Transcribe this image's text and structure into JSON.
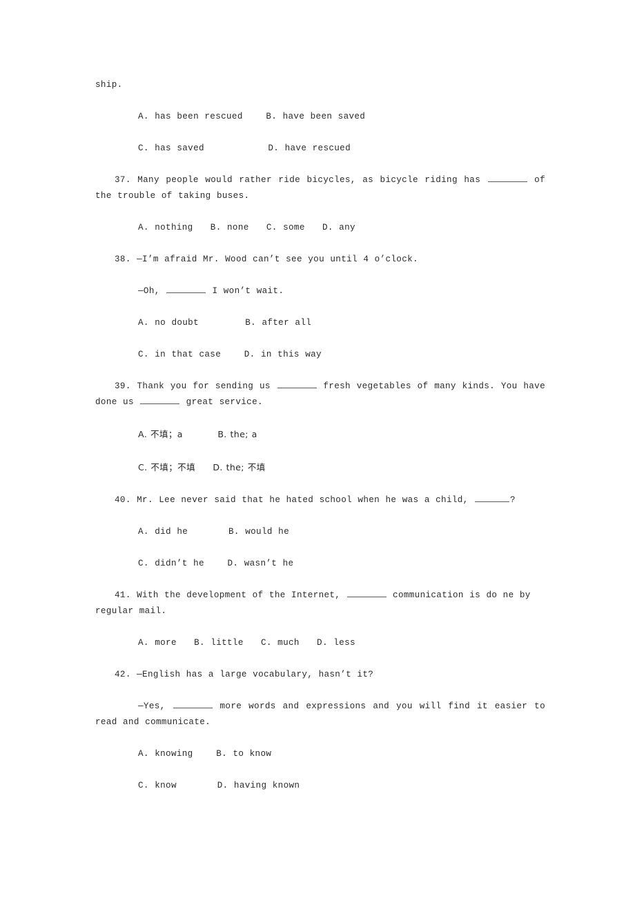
{
  "document": {
    "type": "english-exam-worksheet",
    "language": "en-zh",
    "continued_fragment": "ship.",
    "blank_marker": "________"
  },
  "questions": [
    {
      "number": "",
      "stem_lines": [],
      "options": [
        {
          "label": "A.",
          "text": "has been rescued"
        },
        {
          "label": "B.",
          "text": "have been saved"
        },
        {
          "label": "C.",
          "text": "has saved"
        },
        {
          "label": "D.",
          "text": "have rescued"
        }
      ],
      "option_row_1": "A. has been rescued    B. have been saved",
      "option_row_2": "C. has saved           D. have rescued"
    },
    {
      "number": "37.",
      "stem_before_blank": "37. Many people would rather ride bicycles, as bicycle riding has ",
      "stem_after_blank": " of the trouble of taking buses.",
      "options": [
        {
          "label": "A.",
          "text": "nothing"
        },
        {
          "label": "B.",
          "text": "none"
        },
        {
          "label": "C.",
          "text": "some"
        },
        {
          "label": "D.",
          "text": "any"
        }
      ],
      "option_row_1": "A. nothing   B. none   C. some   D. any"
    },
    {
      "number": "38.",
      "line_1": "38. —I’m afraid Mr. Wood can’t see you until 4 o’clock.",
      "line_2_before_blank": "—Oh, ",
      "line_2_after_blank": " I won’t wait.",
      "options": [
        {
          "label": "A.",
          "text": "no doubt"
        },
        {
          "label": "B.",
          "text": "after all"
        },
        {
          "label": "C.",
          "text": "in that case"
        },
        {
          "label": "D.",
          "text": "in this way"
        }
      ],
      "option_row_1": "A. no doubt        B. after all",
      "option_row_2": "C. in that case    D. in this way"
    },
    {
      "number": "39.",
      "stem_part_1": "39. Thank you for sending us ",
      "stem_part_2": " fresh vegetables of many kinds. You have done us ",
      "stem_part_3": " great service.",
      "options": [
        {
          "label": "A.",
          "text": "不填；a"
        },
        {
          "label": "B.",
          "text": "the; a"
        },
        {
          "label": "C.",
          "text": "不填；不填"
        },
        {
          "label": "D.",
          "text": "the; 不填"
        }
      ],
      "option_row_1_a": "A. 不填；a",
      "option_row_1_b": "B. the; a",
      "option_row_2_a": "C. 不填；不填",
      "option_row_2_b": "D. the; 不填"
    },
    {
      "number": "40.",
      "stem_before_blank": "40. Mr. Lee never said that he hated school when he was a child, ",
      "stem_after_blank": "?",
      "options": [
        {
          "label": "A.",
          "text": "did he"
        },
        {
          "label": "B.",
          "text": "would he"
        },
        {
          "label": "C.",
          "text": "didn’t he"
        },
        {
          "label": "D.",
          "text": "wasn’t he"
        }
      ],
      "option_row_1": "A. did he       B. would he",
      "option_row_2": "C. didn’t he    D. wasn’t he"
    },
    {
      "number": "41.",
      "stem_before_blank": "41. With the development of the Internet, ",
      "stem_after_blank": " communication is do ne by regular mail.",
      "options": [
        {
          "label": "A.",
          "text": "more"
        },
        {
          "label": "B.",
          "text": "little"
        },
        {
          "label": "C.",
          "text": "much"
        },
        {
          "label": "D.",
          "text": "less"
        }
      ],
      "option_row_1": "A. more   B. little   C. much   D. less"
    },
    {
      "number": "42.",
      "line_1": "42. —English has a large vocabulary, hasn’t it?",
      "line_2_before_blank": "—Yes, ",
      "line_2_after_blank": " more words and expressions and you will find it easier to read and communicate.",
      "options": [
        {
          "label": "A.",
          "text": "knowing"
        },
        {
          "label": "B.",
          "text": "to know"
        },
        {
          "label": "C.",
          "text": "know"
        },
        {
          "label": "D.",
          "text": "having known"
        }
      ],
      "option_row_1": "A. knowing    B. to know",
      "option_row_2": "C. know       D. having known"
    }
  ]
}
